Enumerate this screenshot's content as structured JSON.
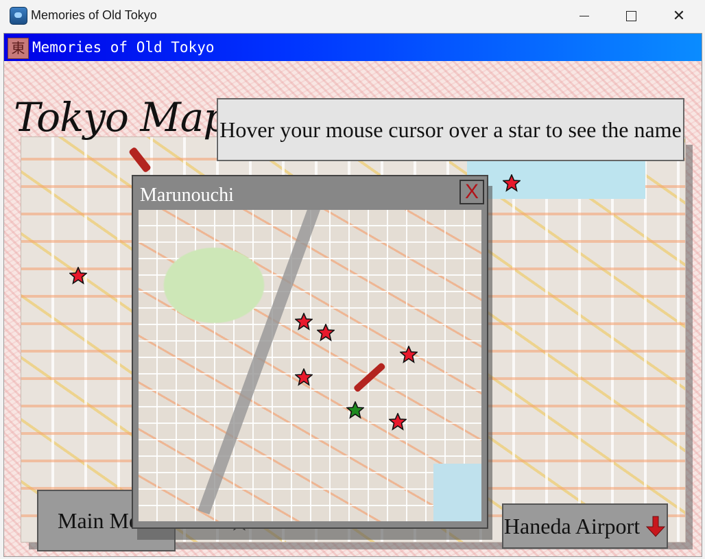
{
  "os_window": {
    "title": "Memories of Old Tokyo",
    "minimize_glyph": "",
    "close_glyph": "✕"
  },
  "game_window": {
    "title": "Memories of Old Tokyo",
    "icon_glyph": "東"
  },
  "header": {
    "title": "Tokyo Map",
    "hint": "Hover your mouse cursor over a star to see the name"
  },
  "popup": {
    "title": "Marunouchi",
    "close_label": "X"
  },
  "buttons": {
    "main_menu": "Main Menu",
    "haneda": "Haneda Airport"
  },
  "colors": {
    "star_red": "#e8192c",
    "star_green": "#1f8a1f",
    "title_bar_blue": "#0033ff",
    "arrow_red": "#c8171d"
  },
  "icons": {
    "star": "star-icon",
    "current_location": "current-location-star-icon",
    "arrow": "arrow-down-icon",
    "close": "close-icon"
  }
}
